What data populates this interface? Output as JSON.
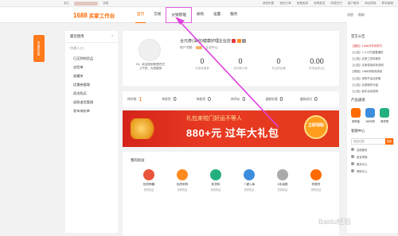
{
  "topbar": {
    "left": [
      "浙江",
      "消息"
    ],
    "right": [
      "我的阿里",
      "我的订单",
      "我是卖家",
      "采购批发",
      "阿里巴巴",
      "客户服务",
      "网站导航",
      "联系客服",
      "收藏夹",
      "访问首页",
      "我是买家"
    ]
  },
  "logo": {
    "brand": "1688",
    "sub": "买家工作台"
  },
  "nav": {
    "tabs": [
      "首页",
      "交易",
      "分销管理",
      "采购",
      "设置",
      "服务"
    ],
    "right": [
      "消息",
      "帮助"
    ]
  },
  "side_badge": "常用新功能",
  "sidebar": {
    "header": "最近使用",
    "section": "快捷入口",
    "items": [
      "已买到的货品",
      "进货单",
      "收藏夹",
      "优惠券管理",
      "再次购买",
      "退款退货管理",
      "发布询价单"
    ]
  },
  "profile": {
    "greeting": "Hi，欢迎来到阿里巴巴",
    "sub": "上午好，为您服务",
    "company": "合元奇(深圳)健康护理企业店",
    "account_label": "账户余额:",
    "account_link": "企业中心"
  },
  "stats": [
    {
      "n": "0",
      "t": "可用优惠券"
    },
    {
      "n": "0",
      "t": "待付款订单"
    },
    {
      "n": "0",
      "t": "关注的店铺"
    },
    {
      "n": "0.00",
      "t": "可用返现(元)"
    }
  ],
  "orders": [
    {
      "label": "待付款",
      "n": "1"
    },
    {
      "label": "待发货",
      "n": "0"
    },
    {
      "label": "待收货",
      "n": "0"
    },
    {
      "label": "待评价",
      "n": "0"
    },
    {
      "label": "退款处理",
      "n": "0"
    },
    {
      "label": "退款成功",
      "n": "0"
    }
  ],
  "banner": {
    "t1": "礼包来啦门好运不等人",
    "t2": "880+元 过年大礼包",
    "cta": "立即领取"
  },
  "rights": {
    "header": "我的权益",
    "items": [
      {
        "l1": "找货神器",
        "l2": "查看权益",
        "color": "#e8553a"
      },
      {
        "l1": "优质采购",
        "l2": "查看权益",
        "color": "#ff8a1f"
      },
      {
        "l1": "收货码",
        "l2": "查看权益",
        "color": "#23b07d"
      },
      {
        "l1": "一键入库",
        "l2": "查看权益",
        "color": "#3c8ddc"
      },
      {
        "l1": "0手续费",
        "l2": "查看权益",
        "color": "#aaaaaa"
      },
      {
        "l1": "同类货",
        "l2": "查看权益",
        "color": "#ff6a00"
      }
    ]
  },
  "right_panel": {
    "header": "官方公告",
    "news": [
      "【通知】1688开年采购节",
      "【公告】7.4 小时重要通知",
      "【公告】买家工具年服务",
      "【公告】买家信用体系说明",
      "【规则】1688采购商规则",
      "【公告】采购节活动说明",
      "【公告】买家服务升级",
      "【公告】新年活动说明"
    ],
    "products_header": "产品通道",
    "products": [
      {
        "n": "采购宝",
        "c": "#ff6a00"
      },
      {
        "n": "1688贷",
        "c": "#3c8ddc"
      },
      {
        "n": "商学院",
        "c": "#23b07d"
      }
    ],
    "service_header": "客服中心",
    "search_placeholder": "搜索问题",
    "search_btn": "搜索",
    "services": [
      "自助服务",
      "投诉举报",
      "服务中心",
      "帮助中心"
    ]
  },
  "watermark": "Baidu经验"
}
